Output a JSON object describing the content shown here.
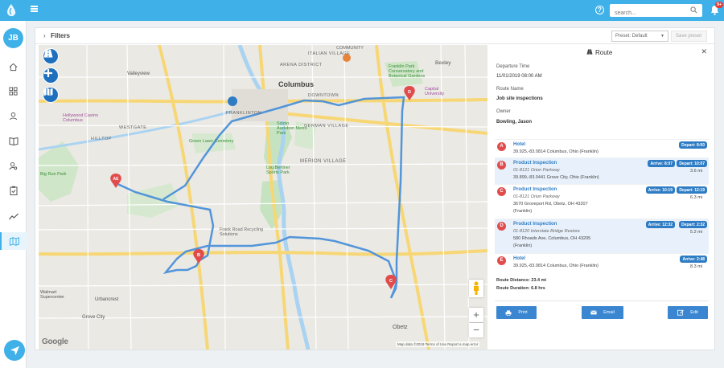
{
  "topbar": {
    "search_placeholder": "search...",
    "notification_count": "9+",
    "accent_color": "#3fb1e8"
  },
  "sidebar": {
    "user_initials": "JB",
    "items": [
      {
        "icon": "home-icon"
      },
      {
        "icon": "dashboard-grid-icon"
      },
      {
        "icon": "user-icon"
      },
      {
        "icon": "book-icon"
      },
      {
        "icon": "user-search-icon"
      },
      {
        "icon": "clipboard-icon"
      },
      {
        "icon": "trend-line-icon"
      },
      {
        "icon": "map-icon",
        "active": true
      }
    ],
    "fab_icon": "navigation-arrow-icon"
  },
  "filters": {
    "title": "Filters",
    "preset_selected": "Preset: Default",
    "save_preset_label": "Save preset"
  },
  "map": {
    "labels": [
      "Columbus",
      "Valleyview",
      "Hollywood Casino Columbus",
      "WESTGATE",
      "HILLTOP",
      "Green Lawn Cemetery",
      "Big Run Park",
      "Franklin Park Conservatory and Botanical Gardens",
      "Scioto Audubon Metro Park",
      "GERMAN VILLAGE",
      "Lou Berliner Sports Park",
      "MERION VILLAGE",
      "Frank Road Recycling Solutions",
      "Walmart Supercenter",
      "Urbancrest",
      "Grove City",
      "Obetz",
      "Bexley",
      "Capital University",
      "FRANKLINTON",
      "ARENA DISTRICT",
      "ITALIAN VILLAGE",
      "DOWNTOWN",
      "COMMUNITY"
    ],
    "google_label": "Google",
    "attribution": "Map data ©2019   Terms of Use   Report a map error",
    "zoom_in": "+",
    "zoom_out": "−"
  },
  "route": {
    "title": "Route",
    "departure_time_label": "Departure Time",
    "departure_time": "11/01/2019 08:00 AM",
    "route_name_label": "Route Name",
    "route_name": "Job site inspections",
    "owner_label": "Owner",
    "owner": "Bowling, Jason",
    "stops": [
      {
        "letter": "A",
        "name": "Hotel",
        "line1": "39.925,-83.0814 Columbus, Ohio (Franklin)",
        "line2": "",
        "line3": "",
        "arrive": "",
        "depart": "Depart: 8:00",
        "distance": ""
      },
      {
        "letter": "B",
        "name": "Product Inspection",
        "line1": "01-8121 Orion Parkway",
        "line2": "39.899,-83.0441 Grove City, Ohio (Franklin)",
        "line3": "",
        "arrive": "Arrive: 8:07",
        "depart": "Depart: 10:07",
        "distance": "3.6 mi"
      },
      {
        "letter": "C",
        "name": "Product Inspection",
        "line1": "01-8121 Orion Parkway",
        "line2": "3670 Groveport Rd, Obetz, OH 43207",
        "line3": "(Franklin)",
        "arrive": "Arrive: 10:19",
        "depart": "Depart: 12:19",
        "distance": "6.3 mi"
      },
      {
        "letter": "D",
        "name": "Product Inspection",
        "line1": "01-8120 Interstate Bridge Restore",
        "line2": "580 Rhoads Ave, Columbus, OH 43205",
        "line3": "(Franklin)",
        "arrive": "Arrive: 12:32",
        "depart": "Depart: 2:32",
        "distance": "5.2 mi"
      },
      {
        "letter": "E",
        "name": "Hotel",
        "line1": "39.925,-83.0814 Columbus, Ohio (Franklin)",
        "line2": "",
        "line3": "",
        "arrive": "Arrive: 2:48",
        "depart": "",
        "distance": "8.3 mi"
      }
    ],
    "route_distance": "Route Distance: 23.4 mi",
    "route_duration": "Route Duration: 6.8 hrs",
    "print_label": "Print",
    "email_label": "Email",
    "edit_label": "Edit"
  }
}
